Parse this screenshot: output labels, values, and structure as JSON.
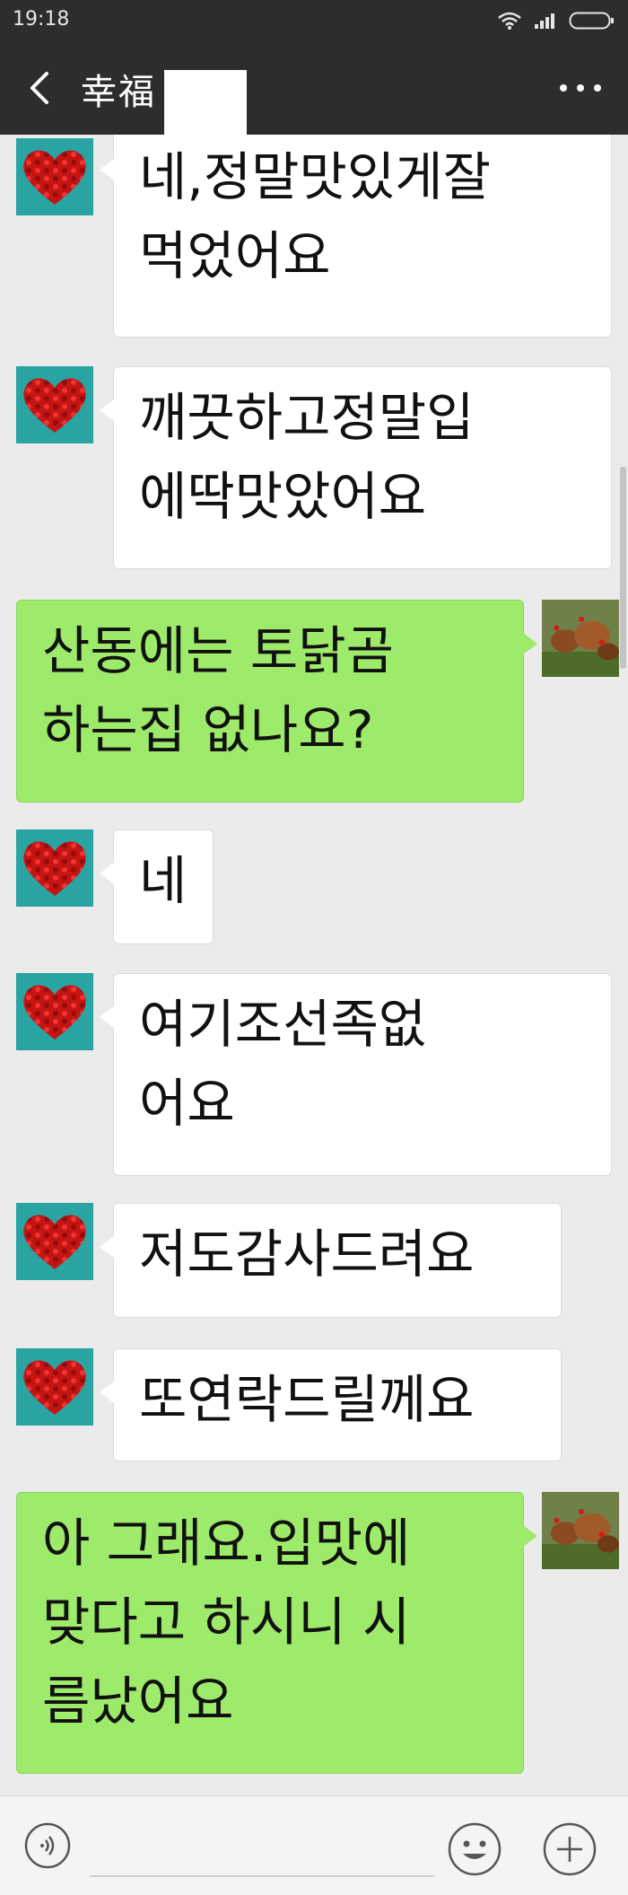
{
  "status_bar": {
    "time": "19:18",
    "icons": [
      "wifi-icon",
      "signal-icon",
      "battery-icon"
    ]
  },
  "header": {
    "back_icon": "chevron-left-icon",
    "title": "幸福",
    "more_icon": "more-dots-icon"
  },
  "messages": [
    {
      "direction": "in",
      "text": "네,정말맛있게잘\n먹었어요",
      "avatar": "rose-heart-avatar"
    },
    {
      "direction": "in",
      "text": "깨끗하고정말입\n에딱맛았어요",
      "avatar": "rose-heart-avatar"
    },
    {
      "direction": "out",
      "text": "산동에는 토닭곰\n하는집 없나요?",
      "avatar": "hens-avatar"
    },
    {
      "direction": "in",
      "text": "네",
      "avatar": "rose-heart-avatar"
    },
    {
      "direction": "in",
      "text": "여기조선족없\n어요",
      "avatar": "rose-heart-avatar"
    },
    {
      "direction": "in",
      "text": "저도감사드려요",
      "avatar": "rose-heart-avatar"
    },
    {
      "direction": "in",
      "text": "또연락드릴께요",
      "avatar": "rose-heart-avatar"
    },
    {
      "direction": "out",
      "text": "아 그래요.입맛에\n맞다고 하시니 시\n름났어요",
      "avatar": "hens-avatar"
    }
  ],
  "input_bar": {
    "voice_icon": "voice-icon",
    "input_value": "",
    "emoji_icon": "emoji-icon",
    "plus_icon": "plus-icon"
  },
  "colors": {
    "header_bg": "#2d2d2d",
    "chat_bg": "#ebebeb",
    "incoming_bubble": "#ffffff",
    "outgoing_bubble": "#9eea6a"
  }
}
